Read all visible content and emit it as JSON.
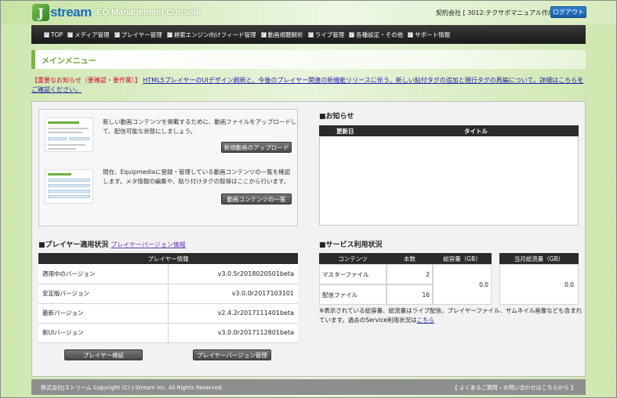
{
  "header": {
    "logo_mark": "J",
    "logo_text": "stream",
    "console_title": "EQ Management Console",
    "account_label": "契約会社 [ 3012:テクサポマニュアル作成用 ]",
    "logout_label": "ログアウト"
  },
  "nav": {
    "items": [
      {
        "label": "TOP"
      },
      {
        "label": "メディア管理"
      },
      {
        "label": "プレイヤー管理"
      },
      {
        "label": "検索エンジン向けフィード管理"
      },
      {
        "label": "動画視聴解析"
      },
      {
        "label": "ライブ管理"
      },
      {
        "label": "各種設定・その他"
      },
      {
        "label": "サポート情報"
      }
    ]
  },
  "main_menu": {
    "title": "メインメニュー"
  },
  "notice": {
    "tag": "【重要なお知らせ（要確認・要作業）】",
    "text": "HTML5プレイヤーのUIデザイン刷新と、今後のプレイヤー関連の新機能リリースに伴う、新しい貼付タグの追加と現行タグの再編について。詳細はこちらをご確認ください。"
  },
  "quick": {
    "upload_desc": "新しい動画コンテンツを掲載するために、動画ファイルをアップロードして、配信可能な状態にしましょう。",
    "upload_button": "新規動画のアップロード",
    "list_desc": "現在、Equipmediaに登録・管理している動画コンテンツの一覧を確認します。メタ情報の編集や、貼り付けタグの取得はここから行います。",
    "list_button": "動画コンテンツの一覧"
  },
  "news": {
    "title": "■お知らせ",
    "col_date": "更新日",
    "col_title": "タイトル"
  },
  "player": {
    "title": "■プレイヤー適用状況",
    "version_link": "プレイヤーバージョン情報",
    "table_header": "プレイヤー情報",
    "rows": [
      {
        "label": "適用中のバージョン",
        "value": "v3.0.5r2018020501beta"
      },
      {
        "label": "安定版バージョン",
        "value": "v3.0.0r2017103101"
      },
      {
        "label": "最新バージョン",
        "value": "v2.4.2r2017111401beta"
      },
      {
        "label": "新UIバージョン",
        "value": "v3.0.0r2017112801beta"
      }
    ],
    "verify_button": "プレイヤー検証",
    "manage_button": "プレイヤーバージョン管理"
  },
  "service": {
    "title": "■サービス利用状況",
    "col_content": "コンテンツ",
    "col_count": "本数",
    "col_total_size": "総容量（GB）",
    "col_monthly_traffic": "当月総流量（GB）",
    "rows": [
      {
        "label": "マスターファイル",
        "count": "2"
      },
      {
        "label": "配信ファイル",
        "count": "16"
      }
    ],
    "total_size": "0.0",
    "monthly_traffic": "0.0",
    "note": "※表示されている総容量、総流量はライブ配信、プレイヤーファイル、サムネイル画像なども含まれています。過去のService利用状況は",
    "note_link": "こちら"
  },
  "footer": {
    "copyright": "株式会社Jストリーム  Copyright (C) J-Stream Inc. All Rights Reserved.",
    "faq": "【 よくあるご質問・お問い合わせはこちらから 】"
  }
}
